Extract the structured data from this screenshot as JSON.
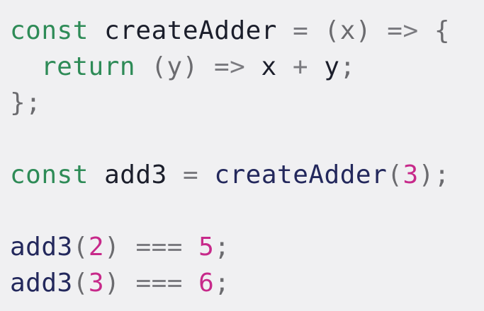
{
  "colors": {
    "background": "#f0f0f2",
    "keyword": "#2e8b57",
    "identifier": "#1b1e2b",
    "function_name": "#23285c",
    "punctuation": "#6b6b6f",
    "number": "#c7298a"
  },
  "code": {
    "line1": {
      "kw": "const",
      "name": "createAdder",
      "eq": "=",
      "params": "(x)",
      "arrow": "=>",
      "brace": "{"
    },
    "line2": {
      "kw": "return",
      "params": "(y)",
      "arrow": "=>",
      "a": "x",
      "plus": "+",
      "b": "y",
      "semi": ";"
    },
    "line3": {
      "close": "};"
    },
    "line5": {
      "kw": "const",
      "name": "add3",
      "eq": "=",
      "call": "createAdder",
      "open": "(",
      "arg": "3",
      "close": ");"
    },
    "line7": {
      "call": "add3",
      "open": "(",
      "arg": "2",
      "close": ")",
      "op": "===",
      "result": "5",
      "semi": ";"
    },
    "line8": {
      "call": "add3",
      "open": "(",
      "arg": "3",
      "close": ")",
      "op": "===",
      "result": "6",
      "semi": ";"
    }
  }
}
